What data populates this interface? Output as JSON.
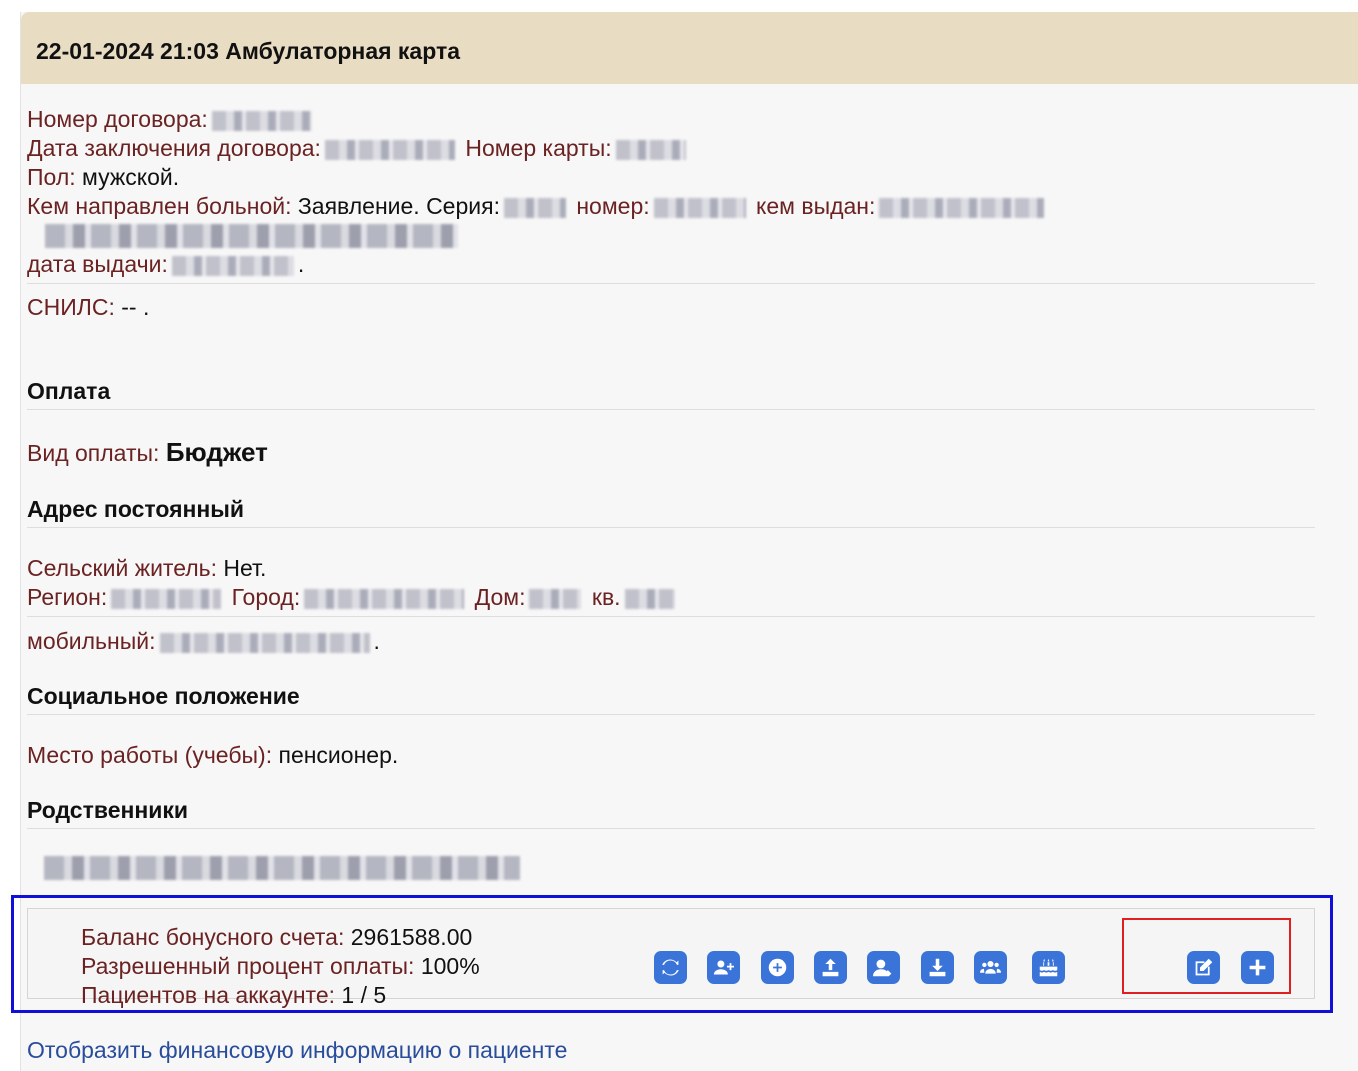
{
  "header": {
    "title": "22-01-2024 21:03 Амбулаторная карта"
  },
  "contract": {
    "number_label": "Номер договора:",
    "date_label": "Дата заключения договора:",
    "card_label": "Номер карты:",
    "gender_label": "Пол:",
    "gender_value": "мужской.",
    "referred_label": "Кем направлен больной:",
    "referred_value": "Заявление. Серия:",
    "number_word": "номер:",
    "issued_by": "кем выдан:",
    "issue_date_label": "дата выдачи:",
    "issue_date_tail": ".",
    "snils_label": "СНИЛС:",
    "snils_value": "-- ."
  },
  "payment": {
    "section_title": "Оплата",
    "type_label": "Вид оплаты:",
    "type_value": "Бюджет"
  },
  "address": {
    "section_title": "Адрес постоянный",
    "rural_label": "Сельский житель:",
    "rural_value": "Нет.",
    "region_label": "Регион:",
    "city_label": "Город:",
    "house_label": "Дом:",
    "apt_label": "кв.",
    "mobile_label": "мобильный:",
    "mobile_tail": "."
  },
  "social": {
    "section_title": "Социальное положение",
    "work_label": "Место работы (учебы):",
    "work_value": "пенсионер."
  },
  "relatives": {
    "section_title": "Родственники"
  },
  "bonus": {
    "balance_label": "Баланс бонусного счета:",
    "balance_value": "2961588.00",
    "percent_label": "Разрешенный процент оплаты:",
    "percent_value": "100%",
    "patients_label": "Пациентов на аккаунте:",
    "patients_value": "1 / 5",
    "icons": [
      "refresh-icon",
      "add-user-icon",
      "plus-circle-icon",
      "upload-icon",
      "user-edit-icon",
      "download-icon",
      "users-icon",
      "birthday-cake-icon",
      "edit-icon",
      "plus-icon"
    ],
    "button_color": "#3a74d9",
    "highlight_color": "#e02020",
    "frame_color": "#1010d8"
  },
  "footer": {
    "finance_link": "Отобразить финансовую информацию о пациенте"
  }
}
